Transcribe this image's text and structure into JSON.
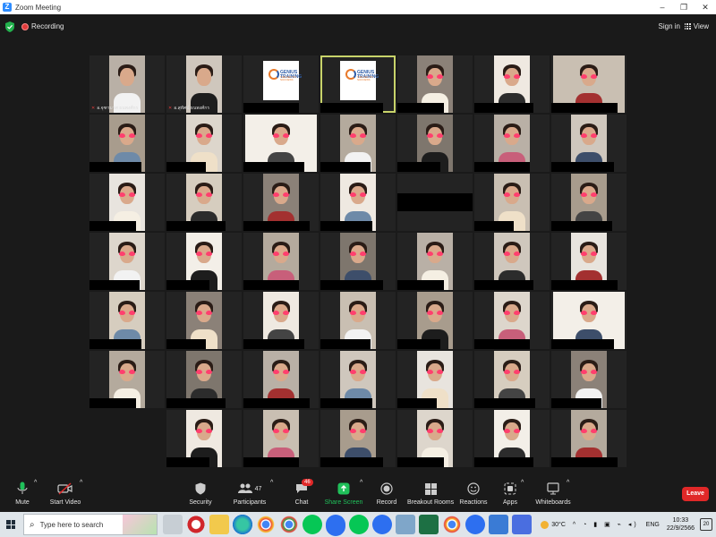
{
  "window": {
    "title": "Zoom Meeting",
    "app_icon": "Z",
    "minimize": "–",
    "maximize": "❐",
    "close": "✕"
  },
  "topbar": {
    "recording_label": "Recording",
    "signin_label": "Sign in",
    "view_label": "View"
  },
  "gallery": {
    "logo_text": "GENIUS TRAINING",
    "logo_tagline": "THE KEY TO SUCCESS",
    "host_name_1": "อ.จุฑามาศ ธนพงศ์กร",
    "host_name_2": "อ.สุทัศน์ ธนพงศ์กร"
  },
  "toolbar": {
    "mute": "Mute",
    "start_video": "Start Video",
    "security": "Security",
    "participants": "Participants",
    "participants_count": "47",
    "chat": "Chat",
    "chat_badge": "46",
    "share_screen": "Share Screen",
    "record": "Record",
    "breakout_rooms": "Breakout Rooms",
    "reactions": "Reactions",
    "apps": "Apps",
    "whiteboards": "Whiteboards",
    "leave": "Leave",
    "share_color": "#20c05a",
    "leave_color": "#e02828"
  },
  "taskbar": {
    "search_placeholder": "Type here to search",
    "temperature": "30°C",
    "language": "ENG",
    "time": "10:33",
    "date": "22/9/2566",
    "notifications": "20"
  }
}
